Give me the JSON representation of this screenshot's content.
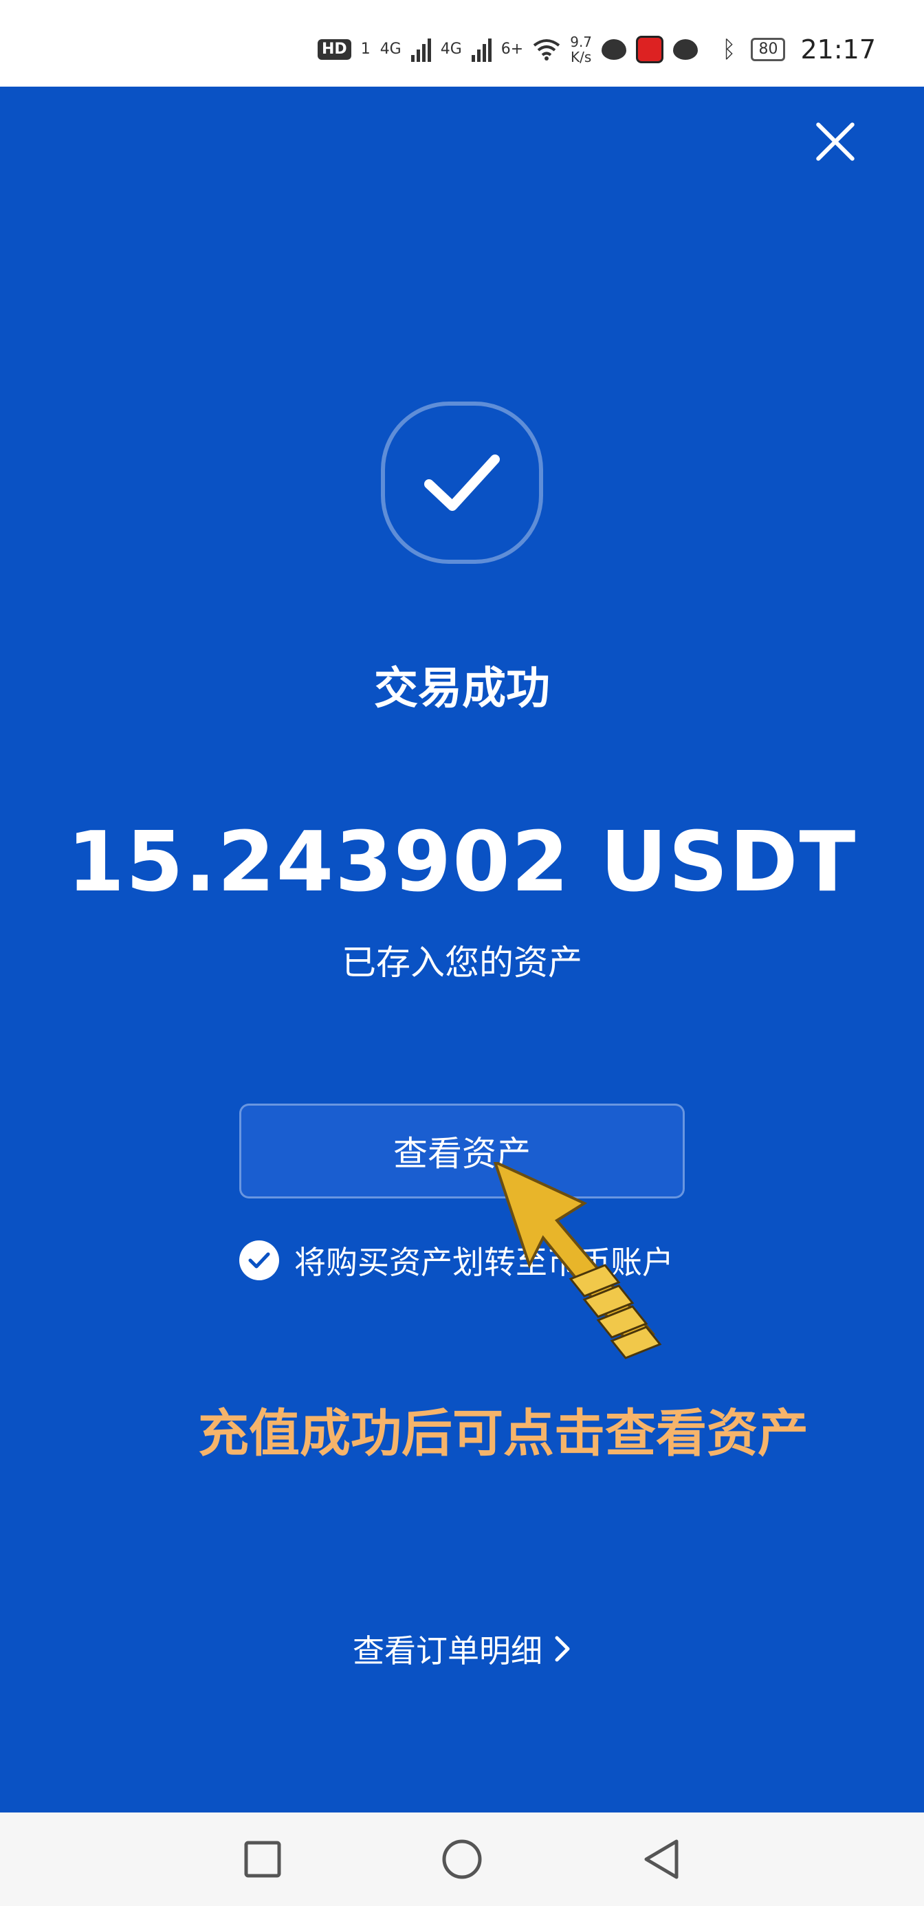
{
  "status_bar": {
    "hd": "HD",
    "sim1": "1",
    "net1": "4G",
    "net2": "4G",
    "net3": "6+",
    "speed_value": "9.7",
    "speed_unit": "K/s",
    "battery": "80",
    "time": "21:17"
  },
  "result": {
    "title": "交易成功",
    "amount": "15.243902 USDT",
    "deposited_text": "已存入您的资产"
  },
  "actions": {
    "view_assets_label": "查看资产",
    "transfer_option_label": "将购买资产划转至币币账户",
    "transfer_option_checked": true,
    "order_details_label": "查看订单明细"
  },
  "annotation": {
    "text": "充值成功后可点击查看资产"
  },
  "colors": {
    "background": "#0a52c4",
    "annotation": "#f6b46a",
    "arrow": "#e8b52a"
  },
  "icons": {
    "close": "close-icon",
    "success": "checkmark-icon",
    "checkbox": "check-circle-icon",
    "chevron": "chevron-right-icon",
    "nav_recent": "square-icon",
    "nav_home": "circle-icon",
    "nav_back": "triangle-back-icon"
  }
}
